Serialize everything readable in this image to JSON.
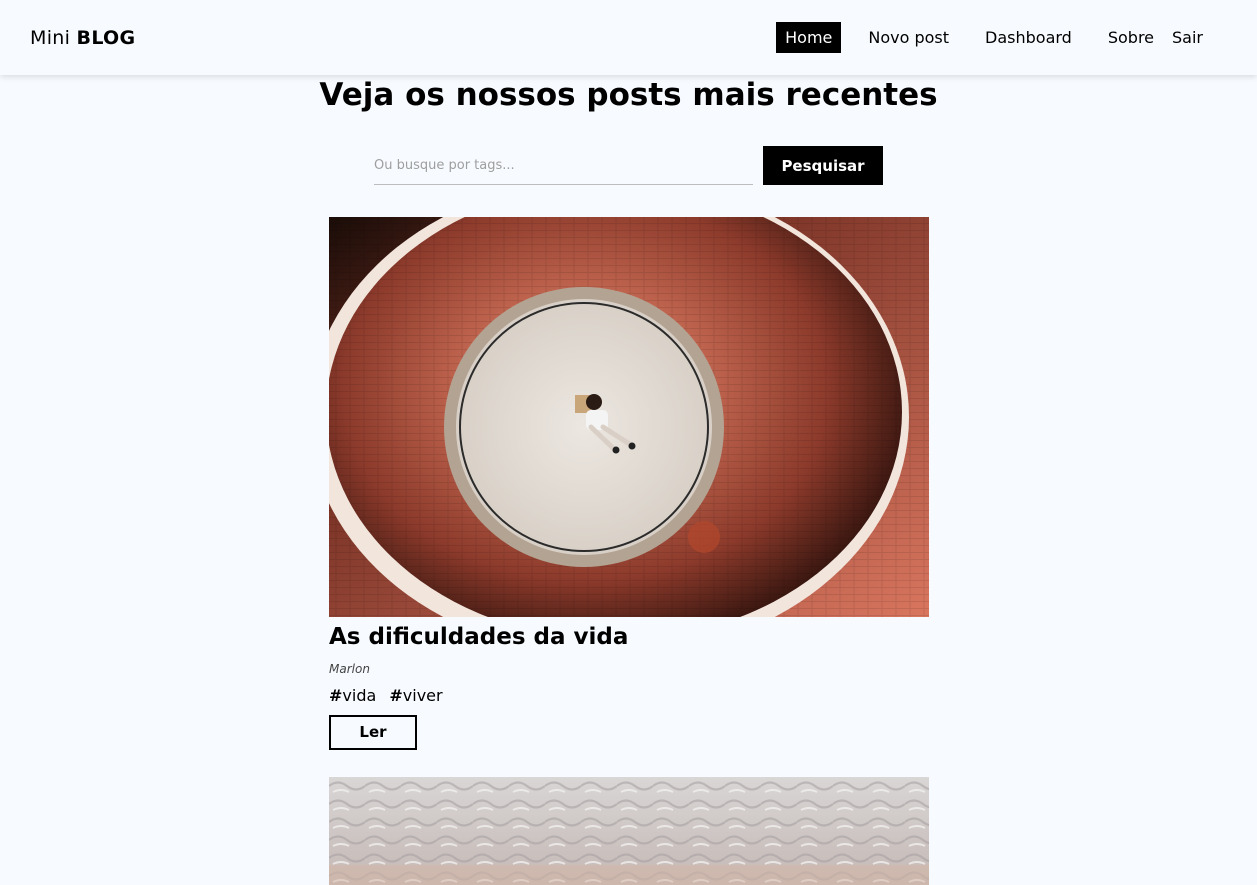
{
  "brand": {
    "prefix": "Mini",
    "name": "BLOG"
  },
  "nav": {
    "items": [
      {
        "label": "Home",
        "active": true
      },
      {
        "label": "Novo post",
        "active": false
      },
      {
        "label": "Dashboard",
        "active": false
      },
      {
        "label": "Sobre",
        "active": false
      },
      {
        "label": "Sair",
        "active": false
      }
    ]
  },
  "main": {
    "title": "Veja os nossos posts mais recentes",
    "search": {
      "placeholder": "Ou busque por tags...",
      "value": "",
      "button_label": "Pesquisar"
    }
  },
  "posts": [
    {
      "title": "As dificuldades da vida",
      "author": "Marlon",
      "tags": [
        "vida",
        "viver"
      ],
      "read_label": "Ler",
      "image": "aerial-brick-circle-person-photo"
    },
    {
      "image": "sand-texture-photo"
    }
  ],
  "colors": {
    "background": "#f7fbff",
    "accent": "#000000",
    "brick": "#c4614a"
  }
}
